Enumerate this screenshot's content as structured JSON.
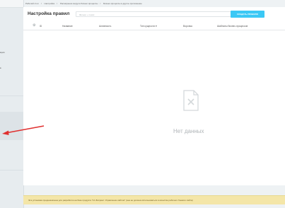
{
  "breadcrumbs": [
    "Рабочий стол",
    "Настройки",
    "Расширение модуля бизнес-процессы",
    "Бизнес-процессы в другое приложение"
  ],
  "sidebar": {
    "fragments": [
      "кции",
      "в"
    ]
  },
  "page": {
    "title": "Настройка правил",
    "search_placeholder": "Фильтр + поиск",
    "add_button": "СОЗДАТЬ ПРАВИЛО"
  },
  "table": {
    "columns": [
      "ID",
      "Название",
      "Активность",
      "Тип сущности",
      "Воронка",
      "Шаблоны бизнес-процессов"
    ],
    "sort_indicator": "▾",
    "empty_text": "Нет данных"
  },
  "notice": "Эта установка предназначена для разработки на базе продукта \"1С-Битрикс: Управление сайтом\" (она не должна использоваться в качестве рабочего боевого сайта)",
  "colors": {
    "accent": "#3bc8f5",
    "annotation_arrow": "#e0302f",
    "notice_bg": "#f4e6a8"
  },
  "icons": [
    "settings-gear-icon",
    "empty-document-icon",
    "clear-icon",
    "annotation-arrow"
  ]
}
